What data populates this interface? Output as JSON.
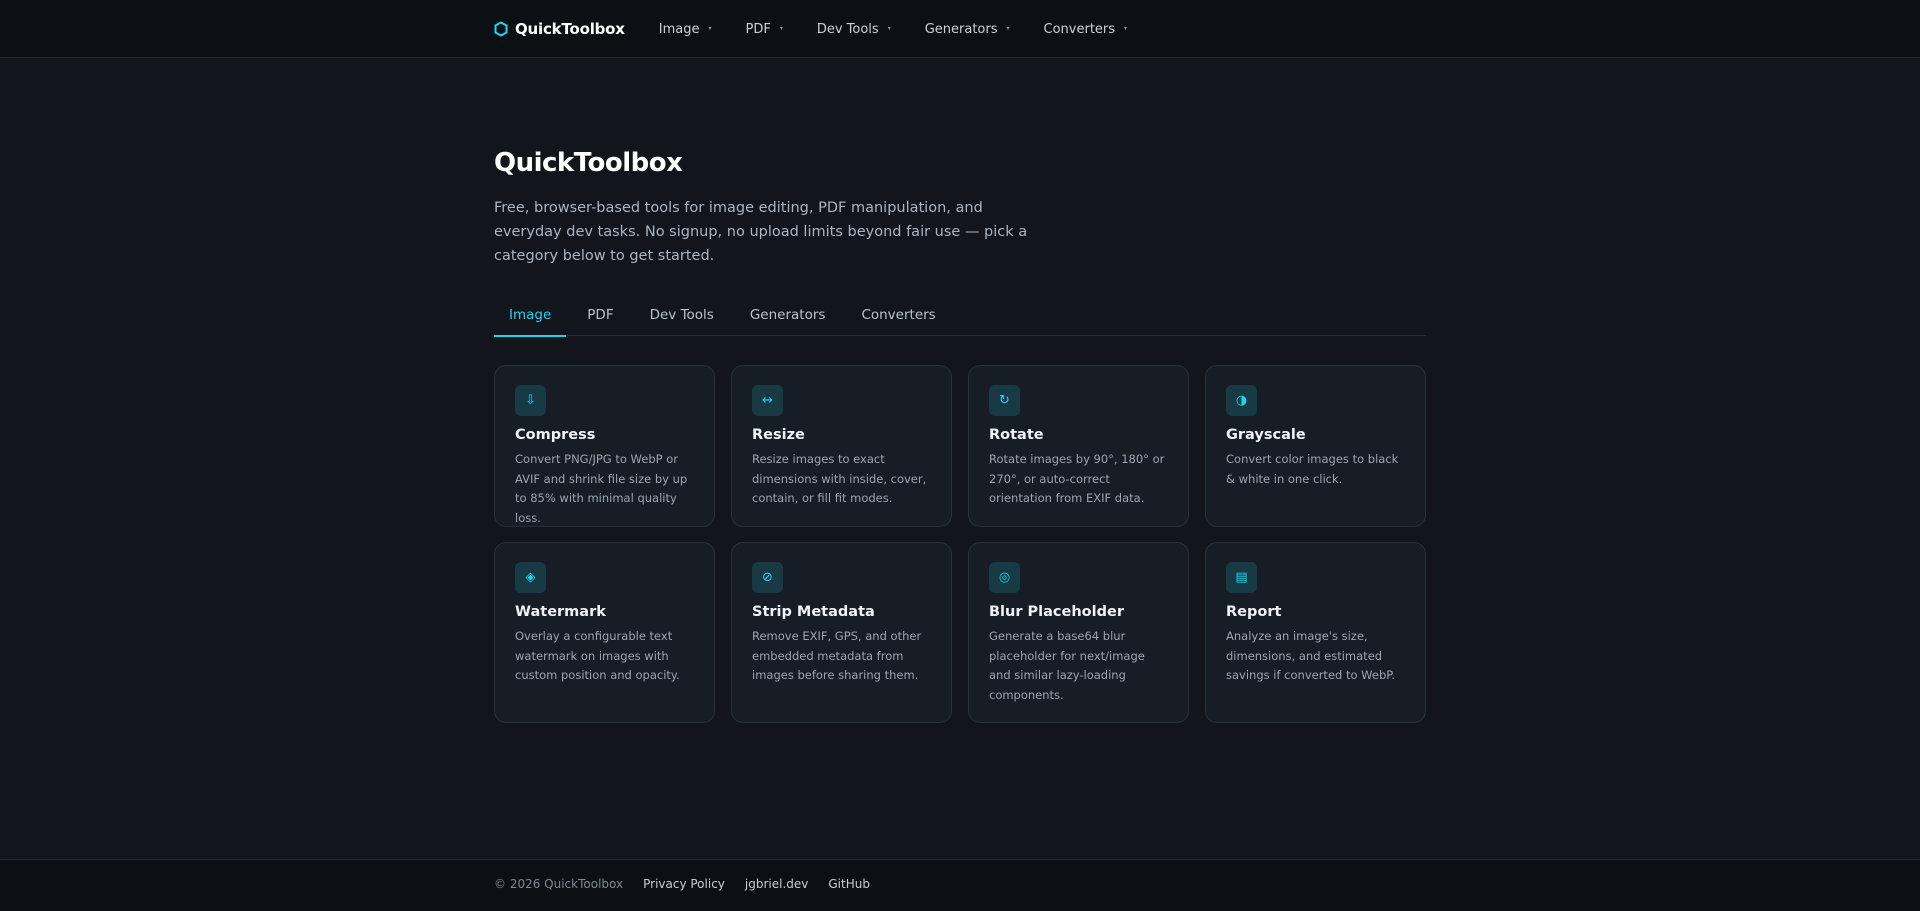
{
  "brand": {
    "name": "QuickToolbox",
    "icon": "hexagon-icon",
    "accent": "#22d3ee"
  },
  "nav": {
    "items": [
      {
        "label": "Image",
        "caret": "▾"
      },
      {
        "label": "PDF",
        "caret": "▾"
      },
      {
        "label": "Dev Tools",
        "caret": "▾"
      },
      {
        "label": "Generators",
        "caret": "▾"
      },
      {
        "label": "Converters",
        "caret": "▾"
      }
    ]
  },
  "hero": {
    "title": "QuickToolbox",
    "description": "Free, browser-based tools for image editing, PDF manipulation, and everyday dev tasks. No signup, no upload limits beyond fair use — pick a category below to get started."
  },
  "tabs": [
    {
      "label": "Image",
      "active": true
    },
    {
      "label": "PDF",
      "active": false
    },
    {
      "label": "Dev Tools",
      "active": false
    },
    {
      "label": "Generators",
      "active": false
    },
    {
      "label": "Converters",
      "active": false
    }
  ],
  "cards": [
    {
      "icon": "download-arrow-icon",
      "glyph": "⇩",
      "title": "Compress",
      "description": "Convert PNG/JPG to WebP or AVIF and shrink file size by up to 85% with minimal quality loss."
    },
    {
      "icon": "resize-arrows-icon",
      "glyph": "↔",
      "title": "Resize",
      "description": "Resize images to exact dimensions with inside, cover, contain, or fill fit modes."
    },
    {
      "icon": "rotate-icon",
      "glyph": "↻",
      "title": "Rotate",
      "description": "Rotate images by 90°, 180° or 270°, or auto-correct orientation from EXIF data."
    },
    {
      "icon": "half-circle-icon",
      "glyph": "◑",
      "title": "Grayscale",
      "description": "Convert color images to black & white in one click."
    },
    {
      "icon": "diamond-icon",
      "glyph": "◈",
      "title": "Watermark",
      "description": "Overlay a configurable text watermark on images with custom position and opacity."
    },
    {
      "icon": "slash-circle-icon",
      "glyph": "⊘",
      "title": "Strip Metadata",
      "description": "Remove EXIF, GPS, and other embedded metadata from images before sharing them."
    },
    {
      "icon": "target-circle-icon",
      "glyph": "◎",
      "title": "Blur Placeholder",
      "description": "Generate a base64 blur placeholder for next/image and similar lazy-loading components."
    },
    {
      "icon": "report-icon",
      "glyph": "▤",
      "title": "Report",
      "description": "Analyze an image's size, dimensions, and estimated savings if converted to WebP."
    }
  ],
  "footer": {
    "copyright": "© 2026 QuickToolbox",
    "links": [
      "Privacy Policy",
      "jgbriel.dev",
      "GitHub"
    ]
  }
}
